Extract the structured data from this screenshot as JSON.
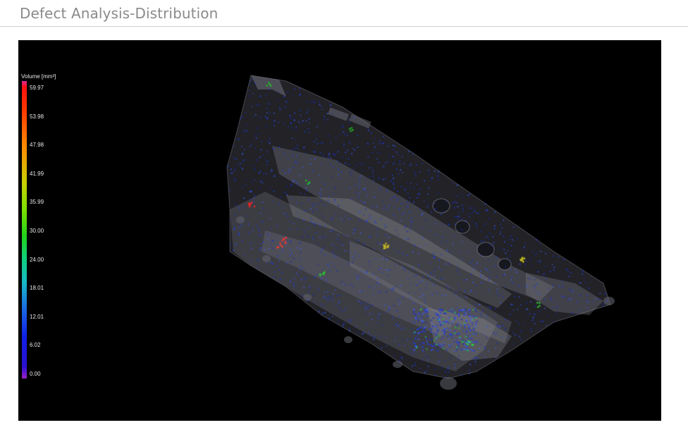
{
  "header": {
    "title": "Defect Analysis-Distribution"
  },
  "legend": {
    "title": "Volume [mm³]",
    "labels": [
      "59.97",
      "53.98",
      "47.98",
      "41.99",
      "35.99",
      "30.00",
      "24.00",
      "18.01",
      "12.01",
      "6.02",
      "0.00"
    ]
  },
  "colors": {
    "background": "#000000",
    "page_background": "#ffffff",
    "title_text": "#8a8a8a",
    "divider": "#cfcfcf",
    "legend_text": "#e8e8e8",
    "model_shade": "#9a9aa8"
  }
}
